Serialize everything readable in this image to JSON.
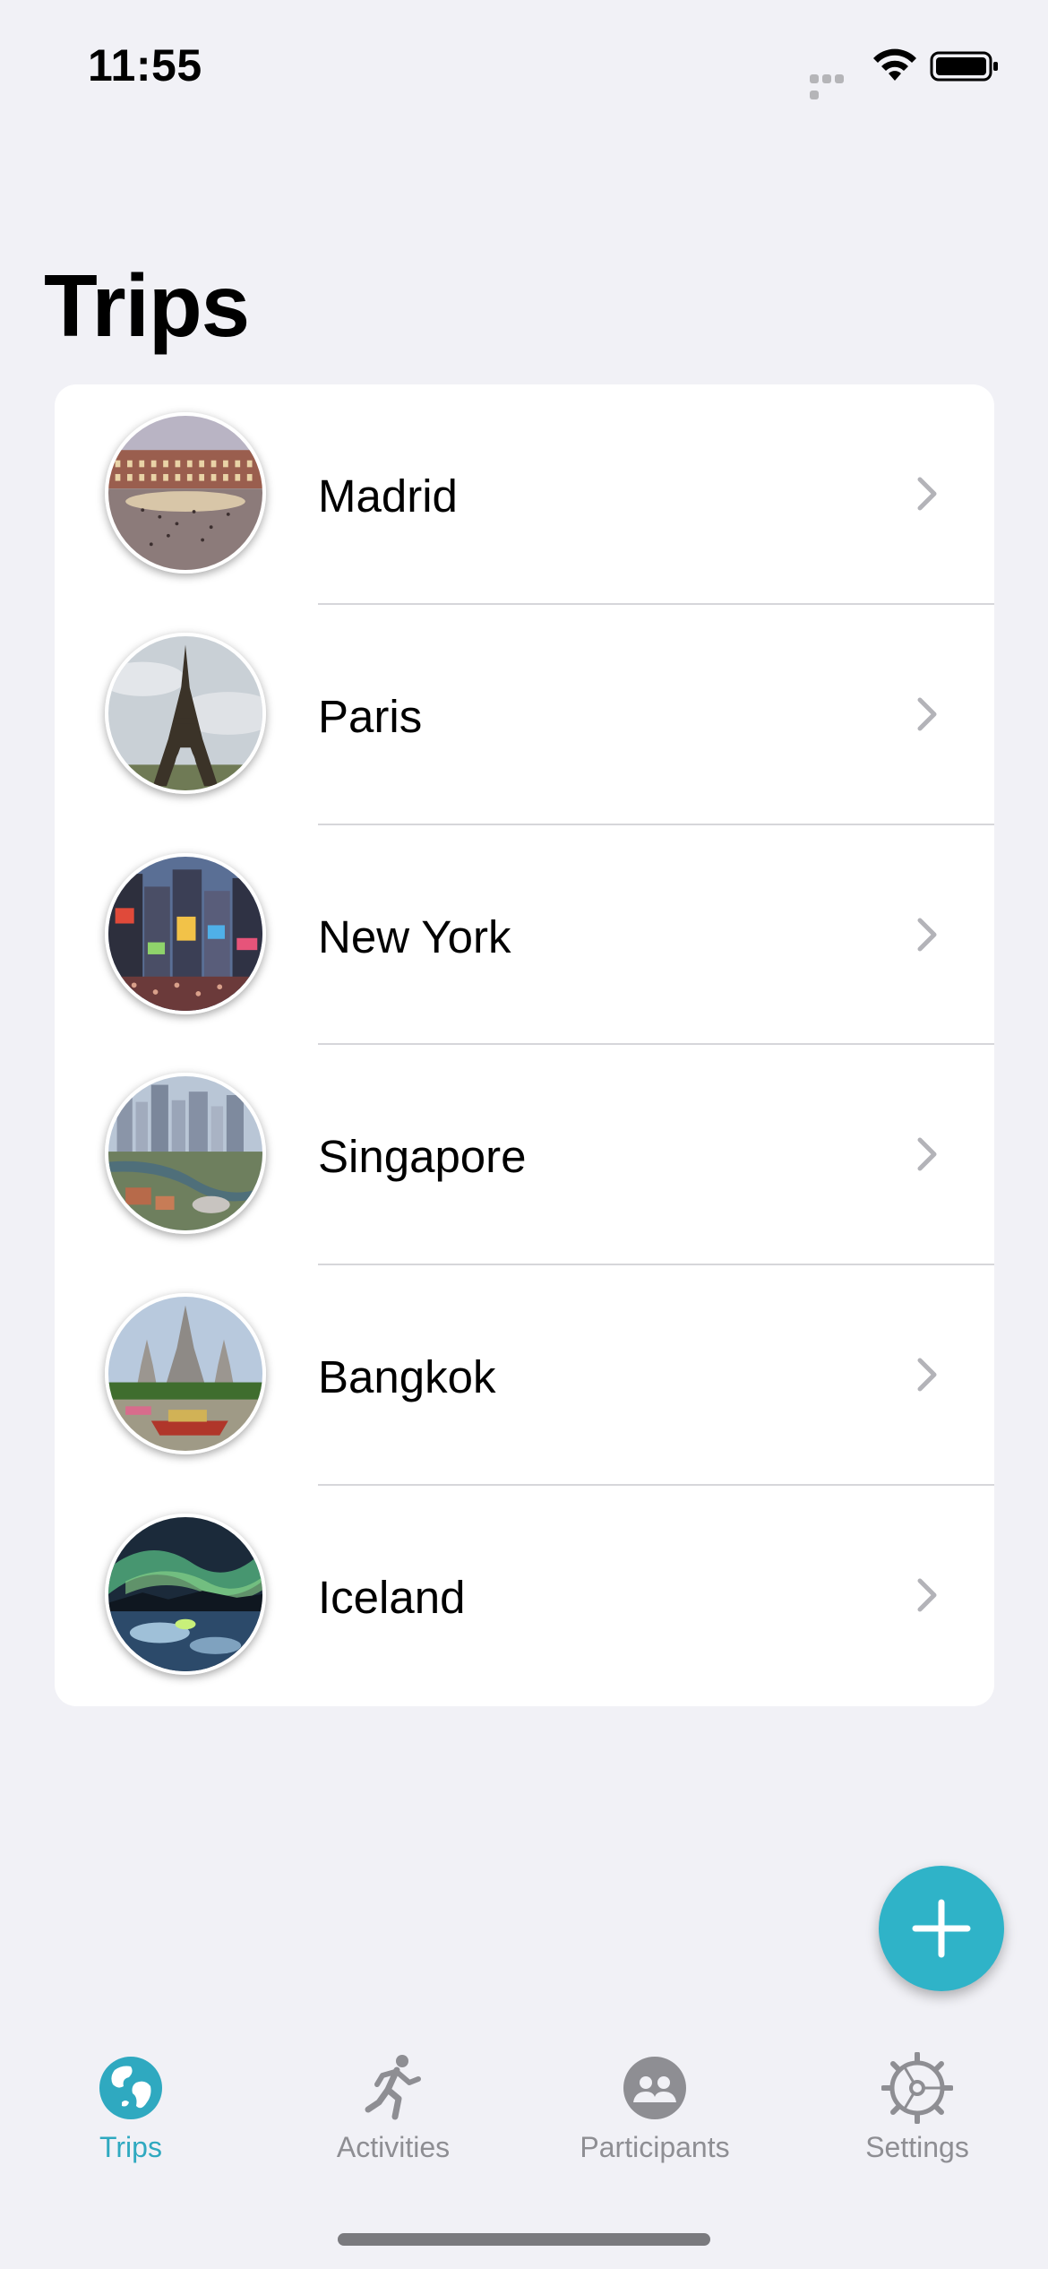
{
  "status_bar": {
    "time": "11:55"
  },
  "page": {
    "title": "Trips"
  },
  "trips": [
    {
      "name": "Madrid",
      "photo": "madrid-plaza-photo"
    },
    {
      "name": "Paris",
      "photo": "paris-eiffel-tower-photo"
    },
    {
      "name": "New York",
      "photo": "new-york-times-square-photo"
    },
    {
      "name": "Singapore",
      "photo": "singapore-skyline-photo"
    },
    {
      "name": "Bangkok",
      "photo": "bangkok-temple-photo"
    },
    {
      "name": "Iceland",
      "photo": "iceland-aurora-photo"
    }
  ],
  "add_button": {
    "icon": "plus-icon"
  },
  "tab_bar": {
    "active": "Trips",
    "tabs": [
      {
        "label": "Trips",
        "icon": "globe-icon"
      },
      {
        "label": "Activities",
        "icon": "running-person-icon"
      },
      {
        "label": "Participants",
        "icon": "people-icon"
      },
      {
        "label": "Settings",
        "icon": "gear-icon"
      }
    ]
  },
  "colors": {
    "accent": "#2fb3c8",
    "tab_active": "#2fa9c0",
    "tab_inactive": "#8e8e93",
    "background": "#f1f1f6",
    "card": "#ffffff",
    "divider": "#d6d6da"
  }
}
